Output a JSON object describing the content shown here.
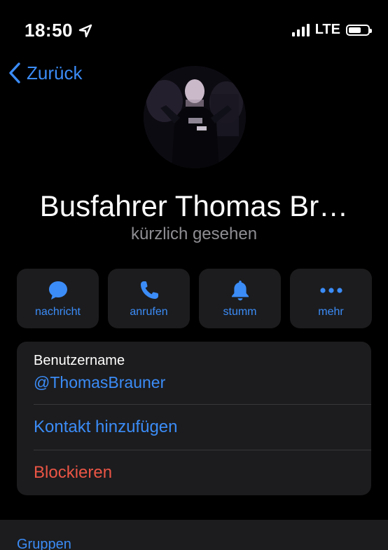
{
  "status_bar": {
    "time": "18:50",
    "network": "LTE"
  },
  "nav": {
    "back_label": "Zurück"
  },
  "profile": {
    "name": "Busfahrer Thomas Br…",
    "last_seen": "kürzlich gesehen"
  },
  "actions": [
    {
      "label": "nachricht",
      "icon": "chat-bubble-icon"
    },
    {
      "label": "anrufen",
      "icon": "phone-icon"
    },
    {
      "label": "stumm",
      "icon": "bell-icon"
    },
    {
      "label": "mehr",
      "icon": "more-dots-icon"
    }
  ],
  "info": {
    "username_label": "Benutzername",
    "username_value": "@ThomasBrauner",
    "add_contact": "Kontakt hinzufügen",
    "block": "Blockieren"
  },
  "tabs": {
    "groups": "Gruppen"
  },
  "colors": {
    "accent": "#3b8cf7",
    "destructive": "#eb5545",
    "card": "#1c1c1e",
    "background": "#000000"
  }
}
